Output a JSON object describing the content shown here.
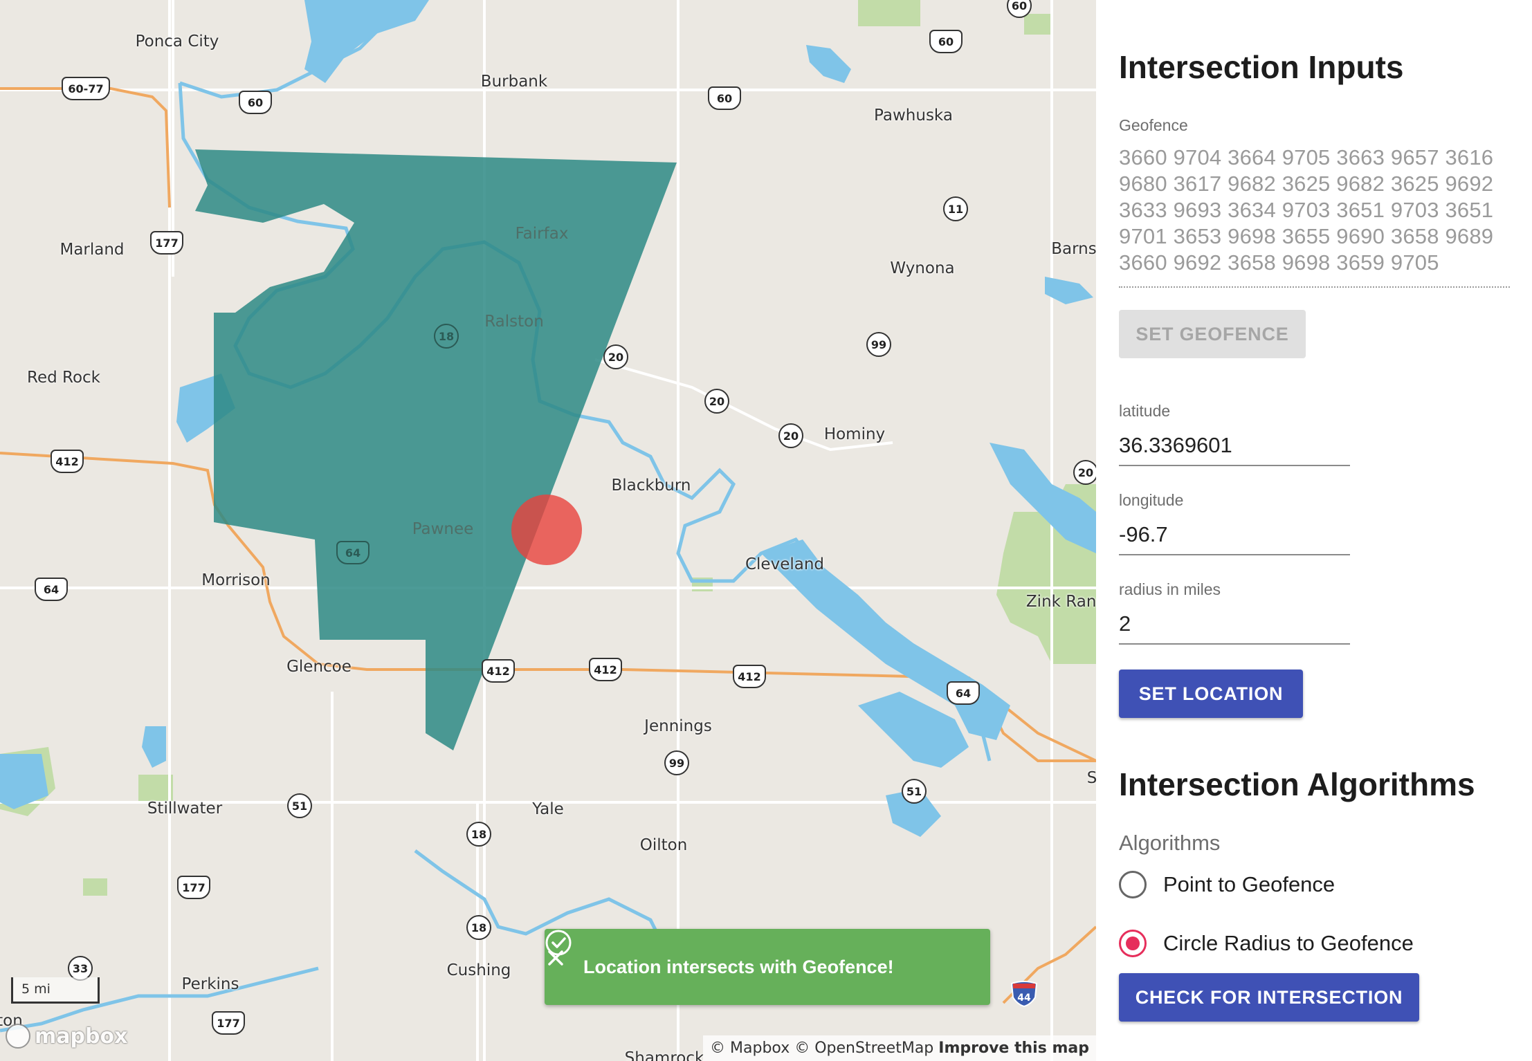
{
  "map": {
    "places": [
      {
        "name": "Ponca City"
      },
      {
        "name": "Burbank"
      },
      {
        "name": "Pawhuska"
      },
      {
        "name": "Marland"
      },
      {
        "name": "Fairfax"
      },
      {
        "name": "Barns"
      },
      {
        "name": "Wynona"
      },
      {
        "name": "Ralston"
      },
      {
        "name": "Red Rock"
      },
      {
        "name": "Hominy"
      },
      {
        "name": "Blackburn"
      },
      {
        "name": "Pawnee"
      },
      {
        "name": "Cleveland"
      },
      {
        "name": "Morrison"
      },
      {
        "name": "Zink Ranc"
      },
      {
        "name": "Glencoe"
      },
      {
        "name": "Jennings"
      },
      {
        "name": "Stillwater"
      },
      {
        "name": "Yale"
      },
      {
        "name": "S"
      },
      {
        "name": "Oilton"
      },
      {
        "name": "Cushing"
      },
      {
        "name": "Perkins"
      },
      {
        "name": "ton"
      },
      {
        "name": "Shamrock"
      }
    ],
    "shields": [
      "60",
      "60",
      "60",
      "60",
      "60-77",
      "177",
      "11",
      "18",
      "20",
      "20",
      "20",
      "99",
      "412",
      "412",
      "412",
      "412",
      "20",
      "64",
      "64",
      "64",
      "99",
      "51",
      "51",
      "18",
      "177",
      "18",
      "33",
      "177",
      "44"
    ],
    "scale_label": "5 mi",
    "logo_text": "mapbox",
    "attribution": {
      "mapbox": "© Mapbox",
      "osm": "© OpenStreetMap",
      "improve": "Improve this map"
    },
    "toast": {
      "message": "Location intersects with Geofence!",
      "color": "#66b05a"
    }
  },
  "panel": {
    "inputs_heading": "Intersection Inputs",
    "geofence_label": "Geofence",
    "geofence_lines": [
      "3660 9704 3664 9705 3663 9657 3616",
      "9680 3617 9682 3625 9682 3625 9692",
      "3633 9693 3634 9703 3651 9703 3651",
      "9701 3653 9698 3655 9690 3658 9689",
      "3660 9692 3658 9698 3659 9705"
    ],
    "set_geofence": "SET GEOFENCE",
    "latitude_label": "latitude",
    "latitude_value": "36.3369601",
    "longitude_label": "longitude",
    "longitude_value": "-96.7",
    "radius_label": "radius in miles",
    "radius_value": "2",
    "set_location": "SET LOCATION",
    "algorithms_heading": "Intersection Algorithms",
    "algorithms_label": "Algorithms",
    "options": [
      {
        "label": "Point to Geofence",
        "selected": false
      },
      {
        "label": "Circle Radius to Geofence",
        "selected": true
      }
    ],
    "check": "CHECK FOR INTERSECTION",
    "accent": "#3f51b5",
    "radio_selected_color": "#e62e5b"
  },
  "colors": {
    "geofence": "#2e8a85",
    "location_circle": "#e8423d",
    "water": "#7fc4e8",
    "land": "#ebe8e2",
    "highway": "#f0a860",
    "park": "#c2dca8"
  }
}
